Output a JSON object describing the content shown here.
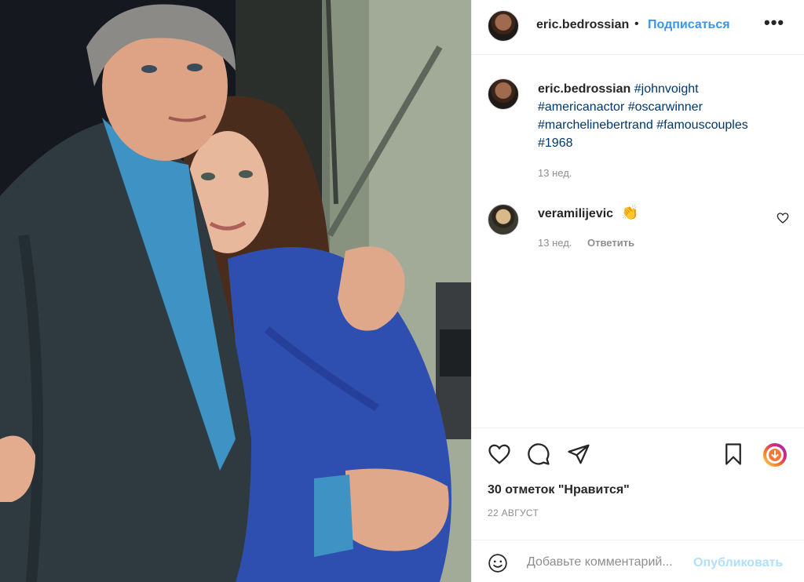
{
  "post": {
    "author": "eric.bedrossian",
    "separator": "•",
    "follow_label": "Подписаться",
    "more_label": "•••",
    "caption": {
      "username": "eric.bedrossian",
      "hashtags": [
        "#johnvoight",
        "#americanactor",
        "#oscarwinner",
        "#marchelinebertrand",
        "#famouscouples",
        "#1968"
      ],
      "time": "13 нед."
    },
    "comments": [
      {
        "username": "veramilijevic",
        "emoji": "👏",
        "time": "13 нед.",
        "reply_label": "Ответить"
      }
    ],
    "likes_text": "30 отметок \"Нравится\"",
    "date": "22 АВГУСТ"
  },
  "comment_box": {
    "placeholder": "Добавьте комментарий...",
    "publish_label": "Опубликовать"
  },
  "icons": {
    "like": "heart-icon",
    "comment": "comment-icon",
    "share": "paper-plane-icon",
    "save": "bookmark-icon",
    "extra": "download-circle-icon",
    "emoji": "smiley-icon"
  },
  "colors": {
    "link": "#00376b",
    "follow": "#3797f0",
    "publish_disabled": "#b2dffc",
    "muted": "#8e8e8e"
  }
}
